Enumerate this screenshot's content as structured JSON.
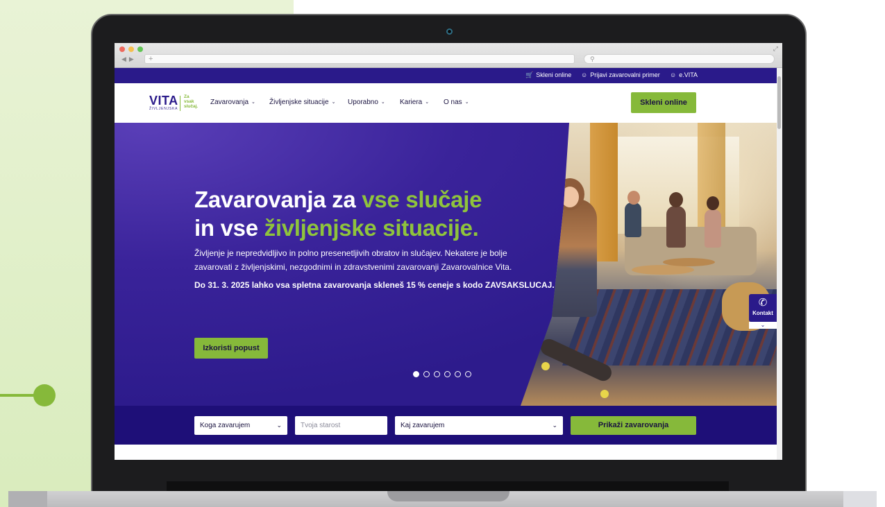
{
  "browser": {
    "address": "+",
    "search_placeholder": "⚲"
  },
  "topbar": {
    "links": [
      {
        "label": "Skleni online",
        "icon": "cart-icon"
      },
      {
        "label": "Prijavi zavarovalni primer",
        "icon": "user-icon"
      },
      {
        "label": "e.VITA",
        "icon": "user-icon"
      }
    ]
  },
  "header": {
    "logo_main": "VITA",
    "logo_sub": "ŽIVLJENJSKA",
    "logo_tag_1": "Za",
    "logo_tag_2": "vsak",
    "logo_tag_3": "slučaj.",
    "menu": [
      {
        "label": "Zavarovanja"
      },
      {
        "label": "Življenjske situacije"
      },
      {
        "label": "Uporabno"
      },
      {
        "label": "Kariera"
      },
      {
        "label": "O nas"
      }
    ],
    "cta_label": "Skleni online"
  },
  "hero": {
    "title_part1": "Zavarovanja za ",
    "title_accent1": "vse slučaje",
    "title_part2": "in vse ",
    "title_accent2": "življenjske situacije.",
    "paragraph": "Življenje je nepredvidljivo in polno presenetljivih obratov in slučajev. Nekatere je bolje zavarovati z življenjskimi, nezgodnimi in zdravstvenimi zavarovanji Zavarovalnice Vita.",
    "promo": "Do 31. 3. 2025 lahko vsa spletna zavarovanja skleneš 15 % ceneje s kodo ZAVSAKSLUCAJ.",
    "button_label": "Izkoristi popust",
    "slides_total": 6,
    "slide_active": 1
  },
  "kontakt": {
    "label": "Kontakt",
    "icon": "phone-icon"
  },
  "filter": {
    "who_value": "Koga zavarujem",
    "age_placeholder": "Tvoja starost",
    "what_value": "Kaj zavarujem",
    "button_label": "Prikaži zavarovanja"
  },
  "colors": {
    "brand_purple": "#2a1a8a",
    "brand_green": "#86b93a",
    "filter_bar": "#1e0f78"
  }
}
